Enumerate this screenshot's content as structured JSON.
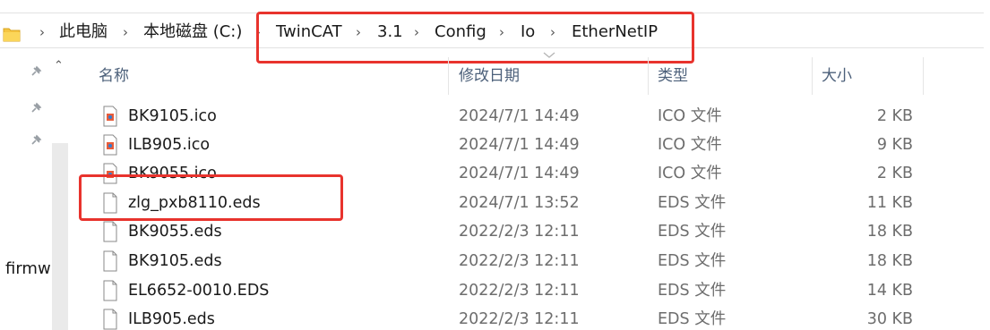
{
  "address_bar": {
    "crumbs": [
      "此电脑",
      "本地磁盘 (C:)",
      "TwinCAT",
      "3.1",
      "Config",
      "Io",
      "EtherNetIP"
    ],
    "separator": "›"
  },
  "nav_pane": {
    "clipped_text": "firmw"
  },
  "columns": {
    "name": "名称",
    "date": "修改日期",
    "type": "类型",
    "size": "大小"
  },
  "files": [
    {
      "name": "BK9105.ico",
      "date": "2024/7/1 14:49",
      "type": "ICO 文件",
      "size": "2 KB",
      "icon": "ico-file-icon"
    },
    {
      "name": "ILB905.ico",
      "date": "2024/7/1 14:49",
      "type": "ICO 文件",
      "size": "9 KB",
      "icon": "ico-file-icon"
    },
    {
      "name": "BK9055.ico",
      "date": "2024/7/1 14:49",
      "type": "ICO 文件",
      "size": "2 KB",
      "icon": "ico-file-icon"
    },
    {
      "name": "zlg_pxb8110.eds",
      "date": "2024/7/1 13:52",
      "type": "EDS 文件",
      "size": "11 KB",
      "icon": "document-icon"
    },
    {
      "name": "BK9055.eds",
      "date": "2022/2/3 12:11",
      "type": "EDS 文件",
      "size": "18 KB",
      "icon": "document-icon"
    },
    {
      "name": "BK9105.eds",
      "date": "2022/2/3 12:11",
      "type": "EDS 文件",
      "size": "18 KB",
      "icon": "document-icon"
    },
    {
      "name": "EL6652-0010.EDS",
      "date": "2022/2/3 12:11",
      "type": "EDS 文件",
      "size": "14 KB",
      "icon": "document-icon"
    },
    {
      "name": "ILB905.eds",
      "date": "2022/2/3 12:11",
      "type": "EDS 文件",
      "size": "30 KB",
      "icon": "document-icon"
    }
  ],
  "colors": {
    "highlight": "#e8332d",
    "header_text": "#4c607a",
    "muted_text": "#6d6d6d"
  }
}
